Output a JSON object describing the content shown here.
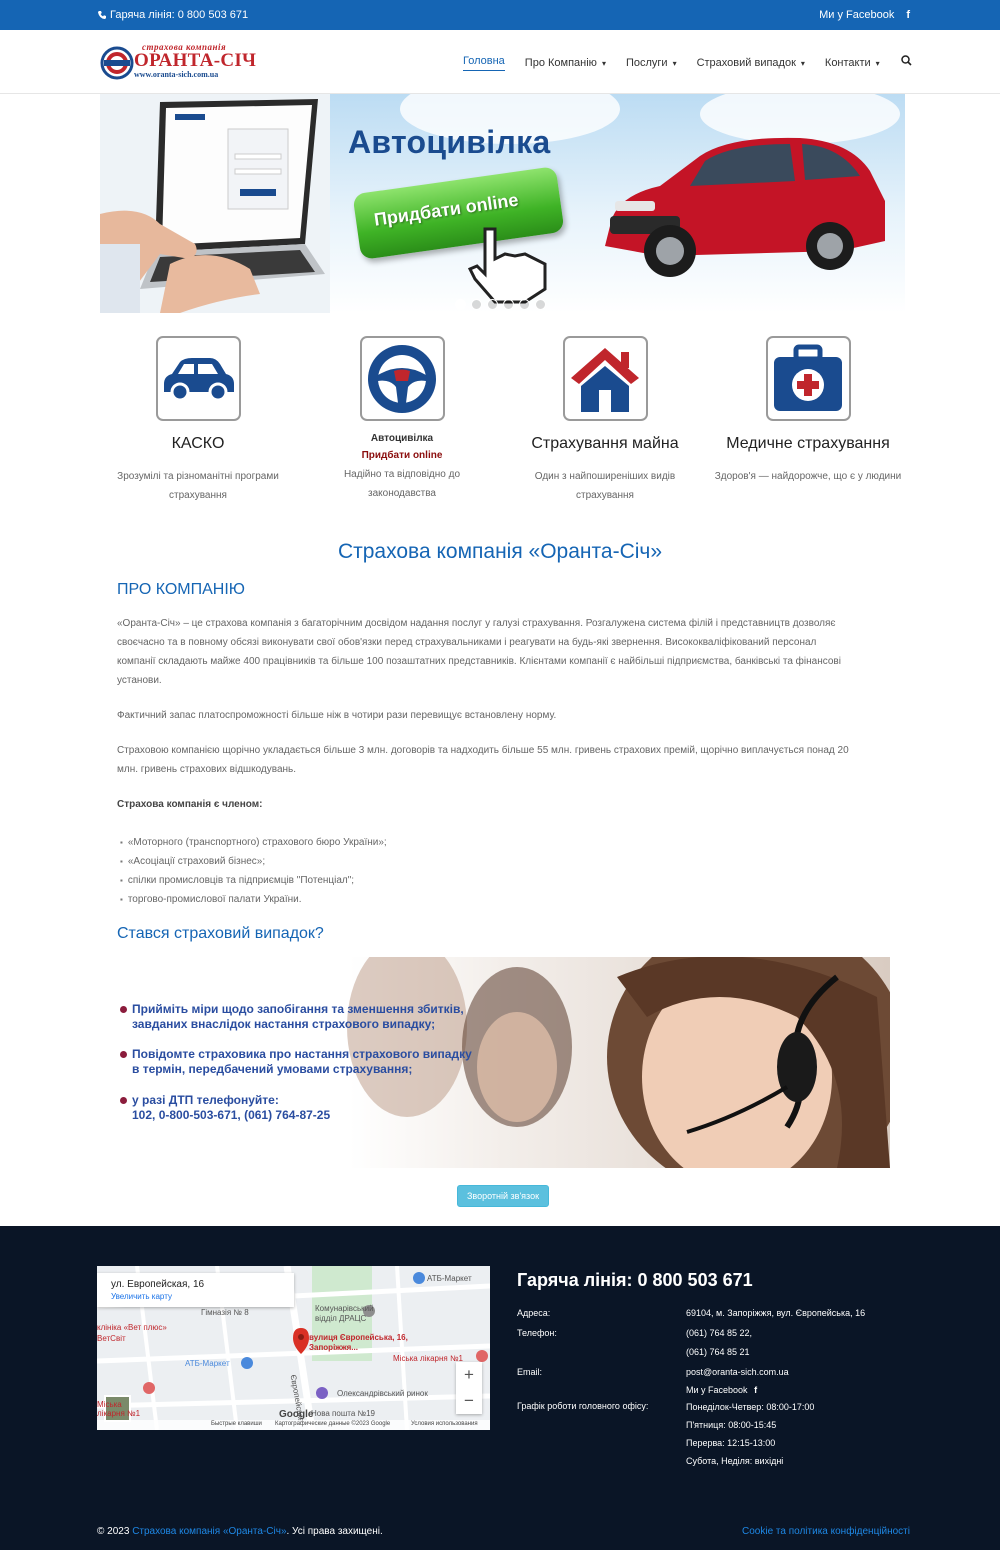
{
  "topbar": {
    "hotline": "Гаряча лінія: 0 800 503 671",
    "facebook": "Ми у Facebook",
    "facebook_icon": "f"
  },
  "logo": {
    "subtitle": "страхова компанія",
    "name": "ОРАНТА-СІЧ",
    "url": "www.oranta-sich.com.ua"
  },
  "nav": {
    "items": [
      {
        "label": "Головна"
      },
      {
        "label": "Про Компанію"
      },
      {
        "label": "Послуги"
      },
      {
        "label": "Страховий випадок"
      },
      {
        "label": "Контакти"
      }
    ],
    "chevron": "▾",
    "search_icon": "⌕"
  },
  "hero": {
    "title": "Автоцивілка",
    "button": "Придбати online",
    "slide_count": 6,
    "active_slide": 1
  },
  "services": [
    {
      "title": "КАСКО",
      "desc1": "Зрозумілі та різноманітні програми",
      "desc2": "страхування",
      "icon": "car-icon"
    },
    {
      "title": "Автоцивілка",
      "subtitle": "Придбати online",
      "desc1": "Надійно та відповідно до",
      "desc2": "законодавства",
      "icon": "steering-wheel-icon"
    },
    {
      "title": "Страхування майна",
      "desc1": "Один з найпоширеніших видів",
      "desc2": "страхування",
      "icon": "house-icon"
    },
    {
      "title": "Медичне страхування",
      "desc1": "Здоров'я — найдорожче, що є у людини",
      "desc2": "",
      "icon": "medical-kit-icon"
    }
  ],
  "main": {
    "heading": "Страхова компанія «Оранта-Січ»",
    "about_heading": "ПРО КОМПАНІЮ",
    "about_p1_l1": "«Оранта-Січ» – це страхова компанія з багаторічним досвідом надання послуг у галузі страхування. Розгалужена система філій і представництв дозволяє",
    "about_p1_l2": "своєчасно та в повному обсязі виконувати свої обов'язки перед страхувальниками і реагувати на будь-які звернення. Висококваліфікований персонал",
    "about_p1_l3": "компанії складають майже 400 працівників та більше 100 позаштатних представників. Клієнтами компанії є найбільші підприємства, банківські та фінансові",
    "about_p1_l4": "установи.",
    "about_p2": "Фактичний запас платоспроможності більше ніж в чотири рази перевищує встановлену норму.",
    "about_p3_l1": "Страховою компанією щорічно укладається більше 3 млн. договорів та надходить більше 55 млн. гривень страхових премій, щорічно виплачується понад 20",
    "about_p3_l2": "млн. гривень страхових відшкодувань.",
    "member_heading": "Страхова компанія є членом:",
    "members": [
      "«Моторного (транспортного) страхового бюро України»;",
      "«Асоціації страховий бізнес»;",
      "спілки промисловців та підприємців \"Потенціал\";",
      "торгово-промислової палати України."
    ],
    "claim_heading": "Стався страховий випадок?",
    "claim_items": [
      {
        "l1": "Прийміть міри щодо запобігання та зменшення збитків,",
        "l2": "завданих внаслідок настання страхового випадку;"
      },
      {
        "l1": "Повідомте страховика про настання страхового випадку",
        "l2": "в термін, передбачений умовами страхування;"
      },
      {
        "l1": "у разі ДТП телефонуйте:",
        "l2": "102, 0-800-503-671, (061) 764-87-25"
      }
    ],
    "feedback_button": "Зворотній зв'язок"
  },
  "footer": {
    "map": {
      "address": "ул. Европейская, 16",
      "enlarge": "Увеличить карту",
      "pin_label_l1": "вулиця Європейська, 16,",
      "pin_label_l2": "Запоріжжя...",
      "labels": [
        "АТБ-Маркет",
        "Гімназія № 8",
        "Комунарівський",
        "відділ ДРАЦС",
        "клініка «Вет плюс»",
        "ВетСвіт",
        "АТБ-Маркет",
        "Міська лікарня №1",
        "Олександрівський ринок",
        "Європейська",
        "Міська",
        "лікарня №1",
        "Нова пошта №19"
      ],
      "attr": [
        "Быстрые клавиши",
        "Картографические данные ©2023 Google",
        "Условия использования"
      ],
      "google": "Google",
      "zoom_in": "+",
      "zoom_out": "−"
    },
    "hotline": "Гаряча лінія: 0 800 503 671",
    "address_label": "Адреса:",
    "address": "69104, м. Запоріжжя, вул. Європейська, 16",
    "phone_label": "Телефон:",
    "phone1": "(061) 764 85 22,",
    "phone2": "(061) 764 85 21",
    "email_label": "Email:",
    "email": "post@oranta-sich.com.ua",
    "facebook": "Ми у Facebook",
    "facebook_icon": "f",
    "schedule_label": "Графік роботи головного офісу:",
    "schedule": [
      "Понеділок-Четвер: 08:00-17:00",
      "П'ятниця: 08:00-15:45",
      "Перерва: 12:15-13:00",
      "Субота, Неділя: вихідні"
    ],
    "copyright_pre": "© 2023",
    "copyright_link": "Страхова компанія «Оранта-Січ»",
    "copyright_post": ". Усі права захищені.",
    "privacy": "Cookie та політика конфіденційності"
  },
  "colors": {
    "brand": "#1565b4",
    "accent_red": "#c0262c",
    "footer_bg": "#0a1526",
    "button_info": "#5bc0de"
  }
}
